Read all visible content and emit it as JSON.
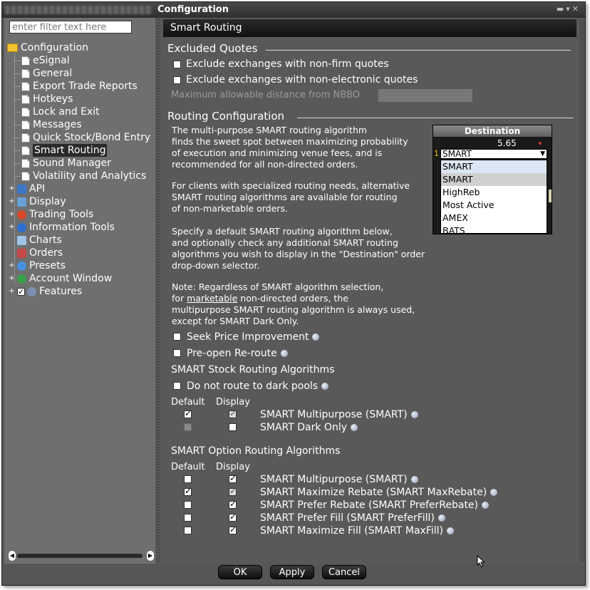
{
  "window": {
    "title": "Configuration"
  },
  "filter": {
    "placeholder": "enter filter text here"
  },
  "tree": {
    "root": "Configuration",
    "items": [
      "eSignal",
      "General",
      "Export Trade Reports",
      "Hotkeys",
      "Lock and Exit",
      "Messages",
      "Quick Stock/Bond Entry",
      "Smart Routing",
      "Sound Manager",
      "Volatility and Analytics"
    ],
    "groups": [
      "API",
      "Display",
      "Trading Tools",
      "Information Tools",
      "Charts",
      "Orders",
      "Presets",
      "Account Window",
      "Features"
    ]
  },
  "panel": {
    "title": "Smart Routing"
  },
  "excluded": {
    "title": "Excluded Quotes",
    "nonfirm": "Exclude exchanges with non-firm quotes",
    "nonelectronic": "Exclude exchanges with non-electronic quotes",
    "nbbo": "Maximum allowable distance from NBBO"
  },
  "routing": {
    "title": "Routing Configuration",
    "p1": [
      "The multi-purpose SMART routing algorithm",
      "finds the sweet spot between maximizing probability",
      "of execution and minimizing venue fees, and is",
      "recommended for all non-directed orders."
    ],
    "p2": [
      "For clients with specialized routing needs, alternative",
      "SMART routing algorithms are available for routing",
      "of non-marketable orders."
    ],
    "p3": [
      "Specify a default SMART routing algorithm below,",
      "and optionally check any additional SMART routing",
      "algorithms you wish to display in the \"Destination\" order",
      "drop-down selector."
    ],
    "note1": "Note: Regardless of SMART algorithm selection,",
    "note2a": "for ",
    "note2u": "marketable",
    "note2b": " non-directed orders, the",
    "note3": "multipurpose SMART routing algorithm is always used,",
    "note4": "except for SMART Dark Only.",
    "seek": "Seek Price Improvement",
    "preopen": "Pre-open Re-route"
  },
  "destination": {
    "header": "Destination",
    "price": "5.65",
    "row_index": "1",
    "selected": "SMART",
    "options": [
      "SMART",
      "SMART",
      "HighReb",
      "Most Active",
      "AMEX",
      "BATS"
    ]
  },
  "stock": {
    "title": "SMART Stock Routing Algorithms",
    "dark": "Do not route to dark pools",
    "col_default": "Default",
    "col_display": "Display",
    "rows": [
      "SMART Multipurpose (SMART)",
      "SMART Dark Only"
    ]
  },
  "option": {
    "title": "SMART Option Routing Algorithms",
    "col_default": "Default",
    "col_display": "Display",
    "rows": [
      "SMART Multipurpose (SMART)",
      "SMART Maximize Rebate (SMART MaxRebate)",
      "SMART Prefer Rebate (SMART PreferRebate)",
      "SMART Prefer Fill (SMART PreferFill)",
      "SMART Maximize Fill (SMART MaxFill)"
    ]
  },
  "buttons": {
    "ok": "OK",
    "apply": "Apply",
    "cancel": "Cancel"
  }
}
